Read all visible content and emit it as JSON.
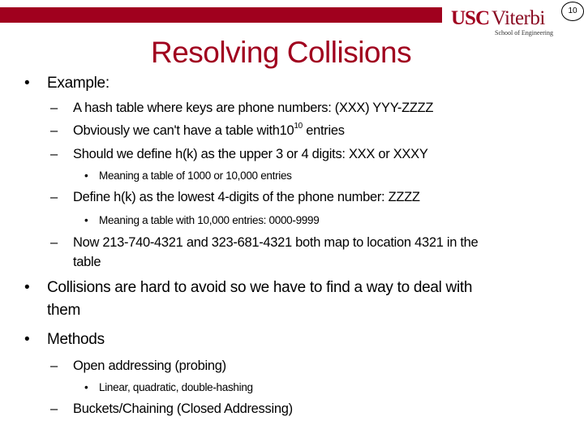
{
  "header": {
    "logo_usc": "USC",
    "logo_viterbi": "Viterbi",
    "logo_sub": "School of Engineering",
    "page_number": "10",
    "accent_color": "#a0001e"
  },
  "title": "Resolving Collisions",
  "bullets": {
    "b1": {
      "marker": "•",
      "text": "Example:"
    },
    "b1_1": {
      "marker": "–",
      "text": "A hash table where keys are phone numbers: (XXX) YYY-ZZZZ"
    },
    "b1_2": {
      "marker": "–",
      "text_before": "Obviously we can't have a table with10",
      "sup": "10",
      "text_after": " entries"
    },
    "b1_3": {
      "marker": "–",
      "text": "Should we define h(k) as the upper 3 or 4 digits:  XXX or XXXY"
    },
    "b1_3_1": {
      "marker": "•",
      "text": "Meaning a table of 1000 or 10,000 entries"
    },
    "b1_4": {
      "marker": "–",
      "text": "Define h(k) as the lowest 4-digits of the phone number: ZZZZ"
    },
    "b1_4_1": {
      "marker": "•",
      "text": "Meaning a table with 10,000 entries: 0000-9999"
    },
    "b1_5": {
      "marker": "–",
      "text_line1": "Now 213-740-4321 and 323-681-4321 both map to location 4321 in the",
      "text_line2": "table"
    },
    "b2": {
      "marker": "•",
      "text_line1": "Collisions are hard to avoid so we have to find a way to deal with",
      "text_line2": "them"
    },
    "b3": {
      "marker": "•",
      "text": "Methods"
    },
    "b3_1": {
      "marker": "–",
      "text": "Open addressing (probing)"
    },
    "b3_1_1": {
      "marker": "•",
      "text": "Linear, quadratic, double-hashing"
    },
    "b3_2": {
      "marker": "–",
      "text": "Buckets/Chaining (Closed Addressing)"
    }
  }
}
